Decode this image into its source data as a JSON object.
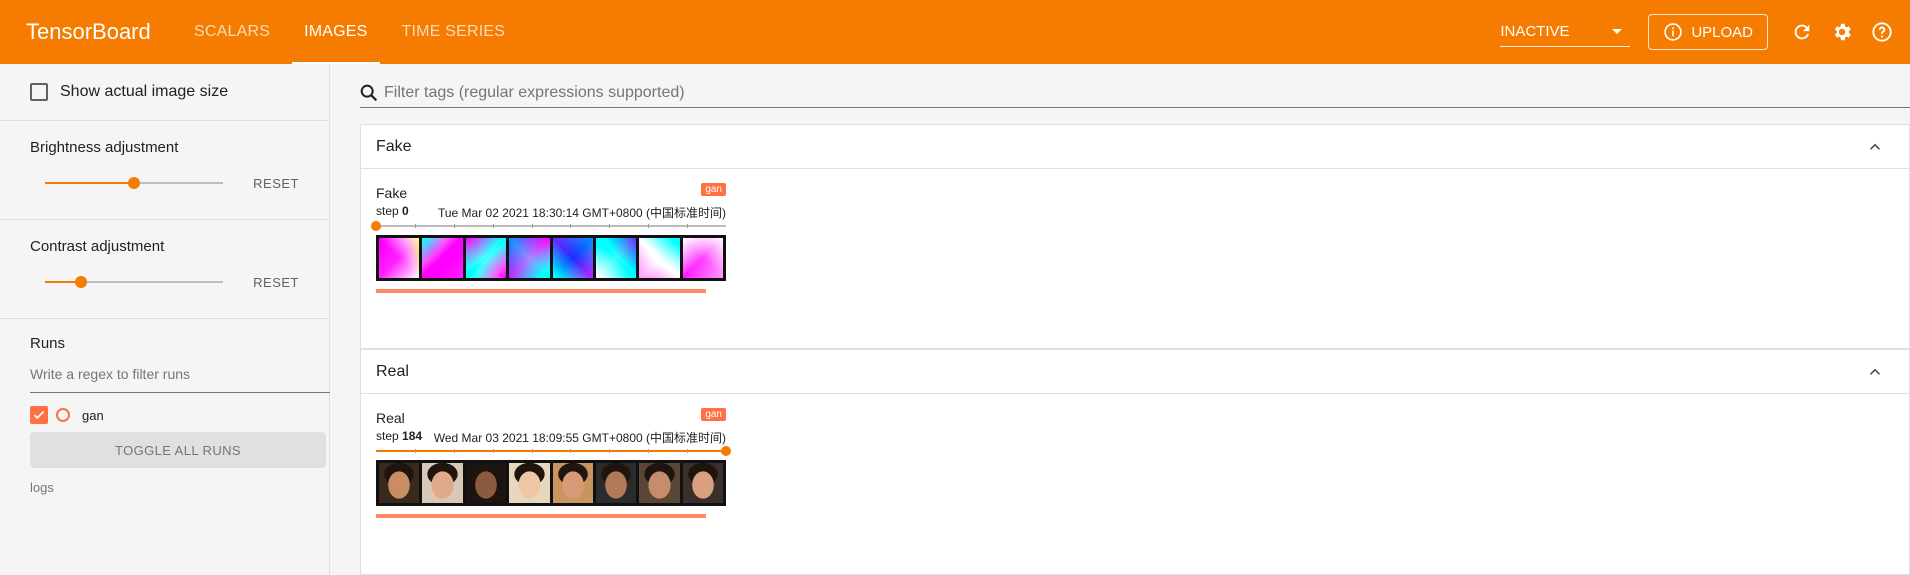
{
  "header": {
    "brand": "TensorBoard",
    "tabs": [
      {
        "label": "SCALARS",
        "active": false
      },
      {
        "label": "IMAGES",
        "active": true
      },
      {
        "label": "TIME SERIES",
        "active": false
      }
    ],
    "status_select": "INACTIVE",
    "upload_label": "UPLOAD",
    "icons": [
      "refresh-icon",
      "settings-gear-icon",
      "help-icon"
    ],
    "accent_color": "#f57c00"
  },
  "sidebar": {
    "show_actual_size_label": "Show actual image size",
    "show_actual_size_checked": false,
    "brightness": {
      "label": "Brightness adjustment",
      "reset_label": "RESET",
      "value_fraction": 0.5
    },
    "contrast": {
      "label": "Contrast adjustment",
      "reset_label": "RESET",
      "value_fraction": 0.2
    },
    "runs": {
      "title": "Runs",
      "filter_placeholder": "Write a regex to filter runs",
      "items": [
        {
          "name": "gan",
          "checked": true,
          "color": "#ff7043"
        }
      ],
      "toggle_all_label": "TOGGLE ALL RUNS",
      "logdir_label": "logs"
    }
  },
  "main": {
    "filter_placeholder": "Filter tags (regular expressions supported)",
    "groups": [
      {
        "title": "Fake",
        "card": {
          "tag": "Fake",
          "run": "gan",
          "step_label": "step",
          "step": "0",
          "timestamp": "Tue Mar 02 2021 18:30:14 GMT+0800 (中国标准时间)",
          "step_fraction": 0.0
        }
      },
      {
        "title": "Real",
        "card": {
          "tag": "Real",
          "run": "gan",
          "step_label": "step",
          "step": "184",
          "timestamp": "Wed Mar 03 2021 18:09:55 GMT+0800 (中国标准时间)",
          "step_fraction": 1.0
        }
      }
    ]
  }
}
